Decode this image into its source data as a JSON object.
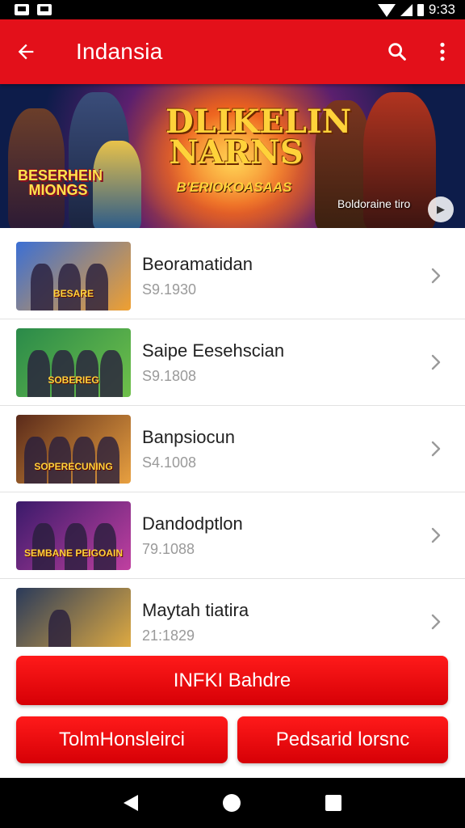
{
  "status_bar": {
    "time": "9:33"
  },
  "app_bar": {
    "title": "Indansia"
  },
  "hero": {
    "title": "DLIKELIN NARNS",
    "subtitle": "B'ERIOKOASAAS",
    "badge": "BESERHEIN MIONGS",
    "caption": "Boldoraine tiro"
  },
  "list": {
    "items": [
      {
        "title": "Beoramatidan",
        "subtitle": "S9.1930",
        "thumb_label": "BESARE",
        "colors": [
          "#3b6fd4",
          "#f0a030"
        ]
      },
      {
        "title": "Saipe Eesehscian",
        "subtitle": "S9.1808",
        "thumb_label": "SOBERIEG",
        "colors": [
          "#2a8a4a",
          "#6fc04a"
        ]
      },
      {
        "title": "Banpsiocun",
        "subtitle": "S4.1008",
        "thumb_label": "SOPERECUNING",
        "colors": [
          "#5a2a1a",
          "#e8a040"
        ]
      },
      {
        "title": "Dandodptlon",
        "subtitle": "79.1088",
        "thumb_label": "SEMBANE PEIGOAIN",
        "colors": [
          "#3a1a6a",
          "#c040a0"
        ]
      },
      {
        "title": "Maytah tiatira",
        "subtitle": "21:1829",
        "thumb_label": "",
        "colors": [
          "#2a3a5a",
          "#e8b040"
        ]
      }
    ]
  },
  "buttons": {
    "primary": "INFKI Bahdre",
    "secondary_left": "TolmHonsleirci",
    "secondary_right": "Pedsarid lorsnc"
  },
  "colors": {
    "brand_red": "#e3101a"
  }
}
